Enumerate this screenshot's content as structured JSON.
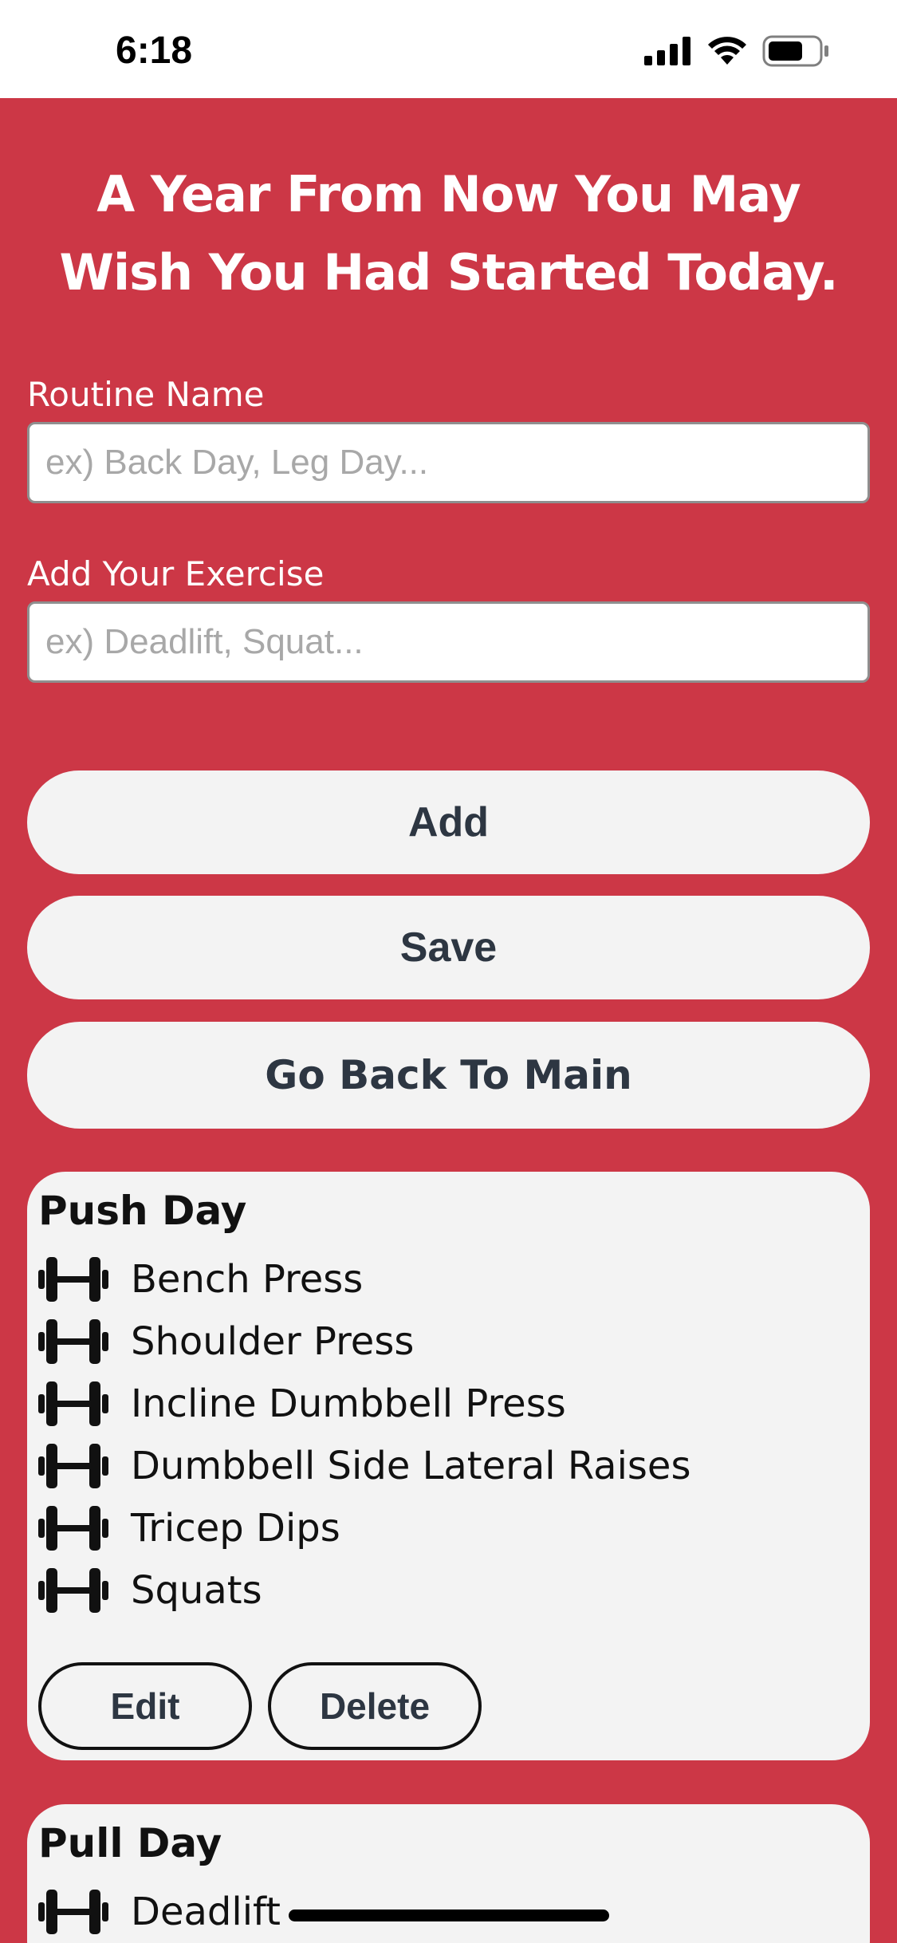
{
  "status_bar": {
    "time": "6:18",
    "icons": [
      "signal-icon",
      "wifi-icon",
      "battery-icon"
    ]
  },
  "headline": "A Year From Now You May Wish You Had Started Today.",
  "form": {
    "routine_label": "Routine Name",
    "routine_placeholder": "ex) Back Day, Leg Day...",
    "routine_value": "",
    "exercise_label": "Add Your Exercise",
    "exercise_placeholder": "ex) Deadlift, Squat...",
    "exercise_value": ""
  },
  "buttons": {
    "add": "Add",
    "save": "Save",
    "go_back": "Go Back To Main"
  },
  "routines": [
    {
      "name": "Push Day",
      "exercises": [
        "Bench Press",
        "Shoulder Press",
        "Incline Dumbbell Press",
        "Dumbbell Side Lateral Raises",
        "Tricep Dips",
        "Squats"
      ],
      "edit_label": "Edit",
      "delete_label": "Delete"
    },
    {
      "name": "Pull Day",
      "exercises": [
        "Deadlift"
      ]
    }
  ],
  "colors": {
    "background": "#cc3746",
    "card": "#f3f3f3",
    "button_text": "#2d3642"
  }
}
